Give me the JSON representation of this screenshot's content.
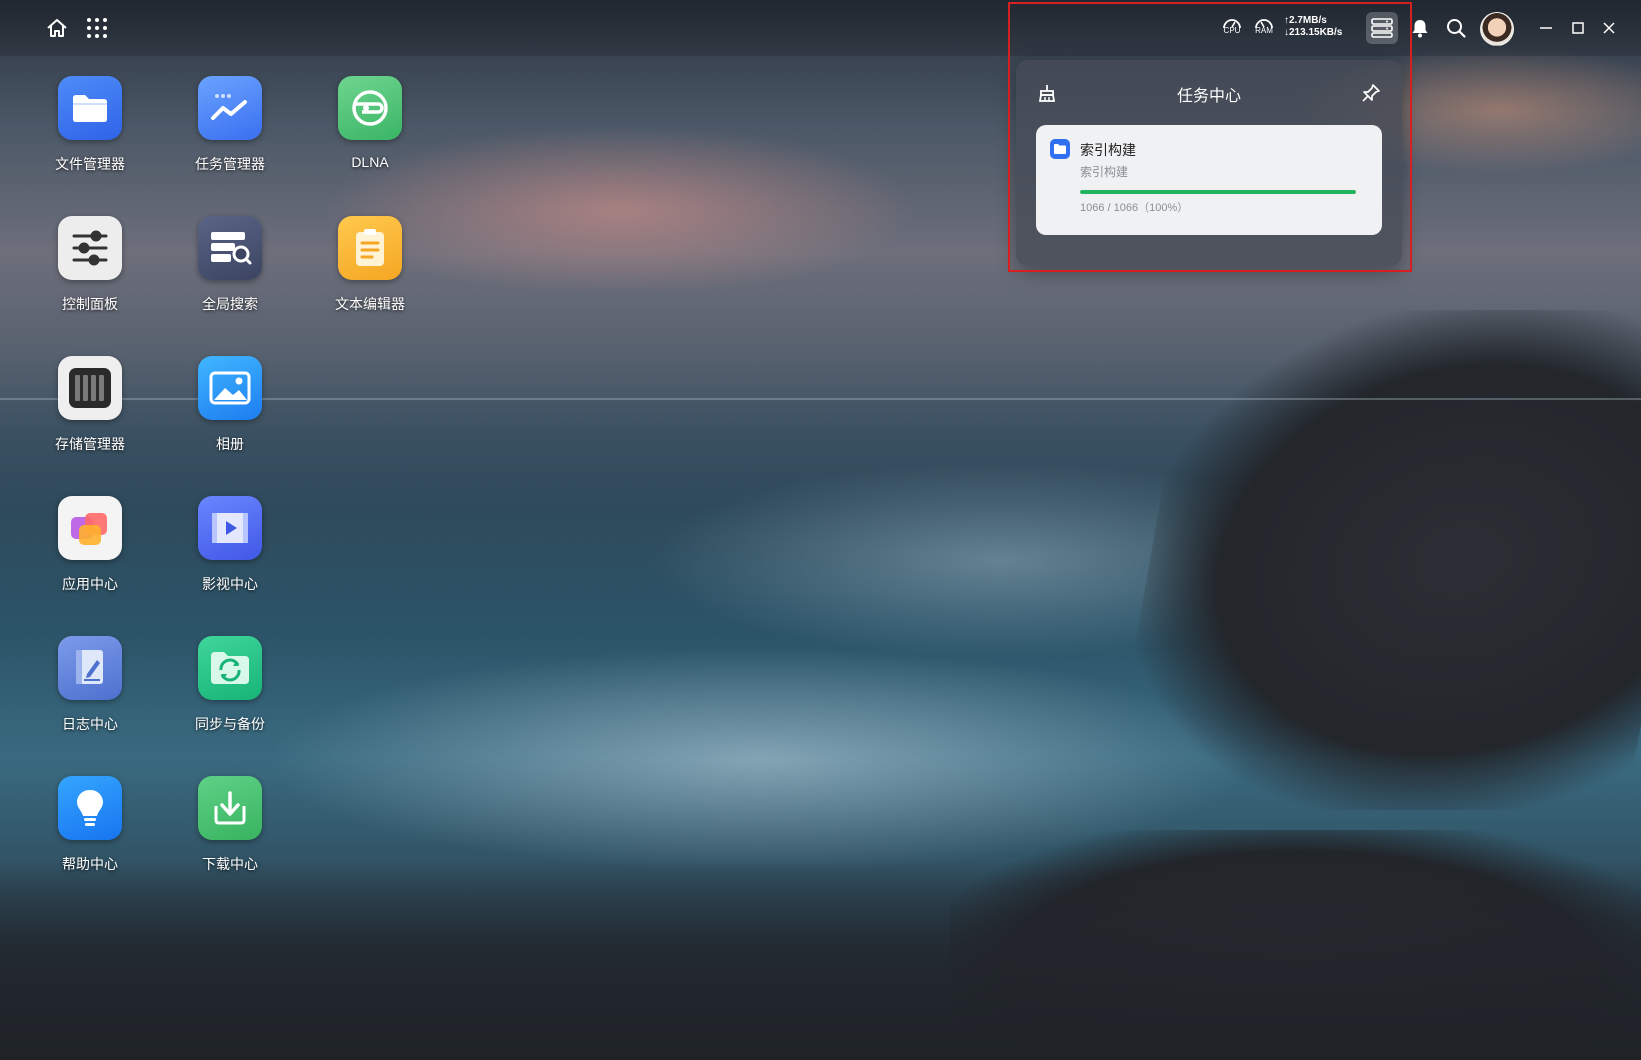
{
  "topbar": {
    "icons": {
      "home": "home-icon",
      "apps": "grid-icon",
      "task_center": "task-center-icon",
      "notifications": "bell-icon",
      "search": "search-icon",
      "minimize": "minimize-icon",
      "maximize": "maximize-icon",
      "close": "close-icon"
    },
    "cpu_label": "CPU",
    "ram_label": "RAM",
    "upload_speed": "↑2.7MB/s",
    "download_speed": "↓213.15KB/s"
  },
  "desktop": {
    "apps": [
      {
        "label": "文件管理器",
        "icon": "folder-icon",
        "color": "#2f6ff0"
      },
      {
        "label": "任务管理器",
        "icon": "task-manager-icon",
        "color": "#3b7cf5"
      },
      {
        "label": "DLNA",
        "icon": "dlna-icon",
        "color": "#4cc47a"
      },
      {
        "label": "控制面板",
        "icon": "sliders-icon",
        "color": "#eeeeee"
      },
      {
        "label": "全局搜索",
        "icon": "global-search-icon",
        "color": "#4a5372"
      },
      {
        "label": "文本编辑器",
        "icon": "notepad-icon",
        "color": "#f6b53a"
      },
      {
        "label": "存储管理器",
        "icon": "storage-icon",
        "color": "#eeeeee"
      },
      {
        "label": "相册",
        "icon": "photo-icon",
        "color": "#2a8ff5"
      },
      {
        "label": "应用中心",
        "icon": "app-center-icon",
        "color": "#f2f2f2"
      },
      {
        "label": "影视中心",
        "icon": "video-icon",
        "color": "#4a69f0"
      },
      {
        "label": "日志中心",
        "icon": "log-icon",
        "color": "#5a7fd6"
      },
      {
        "label": "同步与备份",
        "icon": "sync-icon",
        "color": "#27c48a"
      },
      {
        "label": "帮助中心",
        "icon": "lightbulb-icon",
        "color": "#1f86f5"
      },
      {
        "label": "下载中心",
        "icon": "download-icon",
        "color": "#4cbf6e"
      }
    ]
  },
  "task_center": {
    "title": "任务中心",
    "clean_icon": "broom-icon",
    "pin_icon": "pin-icon",
    "tasks": [
      {
        "name": "索引构建",
        "subtitle": "索引构建",
        "progress_text": "1066 / 1066（100%）",
        "progress": 1.0,
        "bar_color": "#22b35e",
        "icon": "folder-icon"
      }
    ]
  }
}
